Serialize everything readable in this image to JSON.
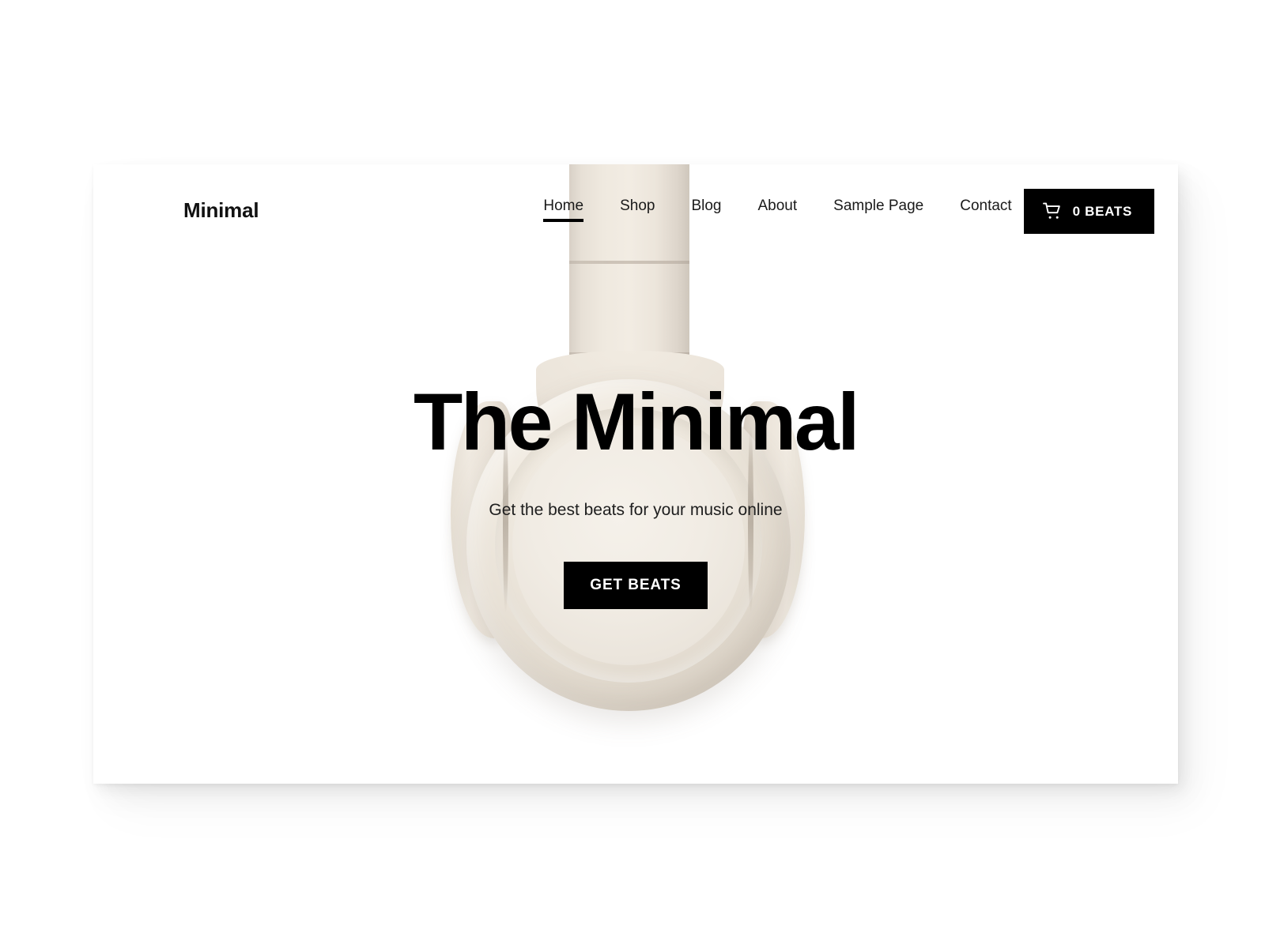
{
  "theme": {
    "accent": "#000000",
    "page_bg": "#ffffff",
    "outer_bg": "#ffffff",
    "text": "#111111",
    "product_cream": "#ece5db"
  },
  "header": {
    "brand": "Minimal",
    "nav": [
      {
        "label": "Home",
        "active": true
      },
      {
        "label": "Shop",
        "active": false
      },
      {
        "label": "Blog",
        "active": false
      },
      {
        "label": "About",
        "active": false
      },
      {
        "label": "Sample Page",
        "active": false
      },
      {
        "label": "Contact",
        "active": false
      }
    ],
    "cart": {
      "icon": "shopping-cart-icon",
      "label": "0 BEATS",
      "count": 0,
      "unit": "BEATS"
    }
  },
  "hero": {
    "title": "The Minimal",
    "subtitle": "Get the best beats for your music online",
    "cta_label": "GET BEATS",
    "background_image_alt": "beige over-ear headphone"
  }
}
